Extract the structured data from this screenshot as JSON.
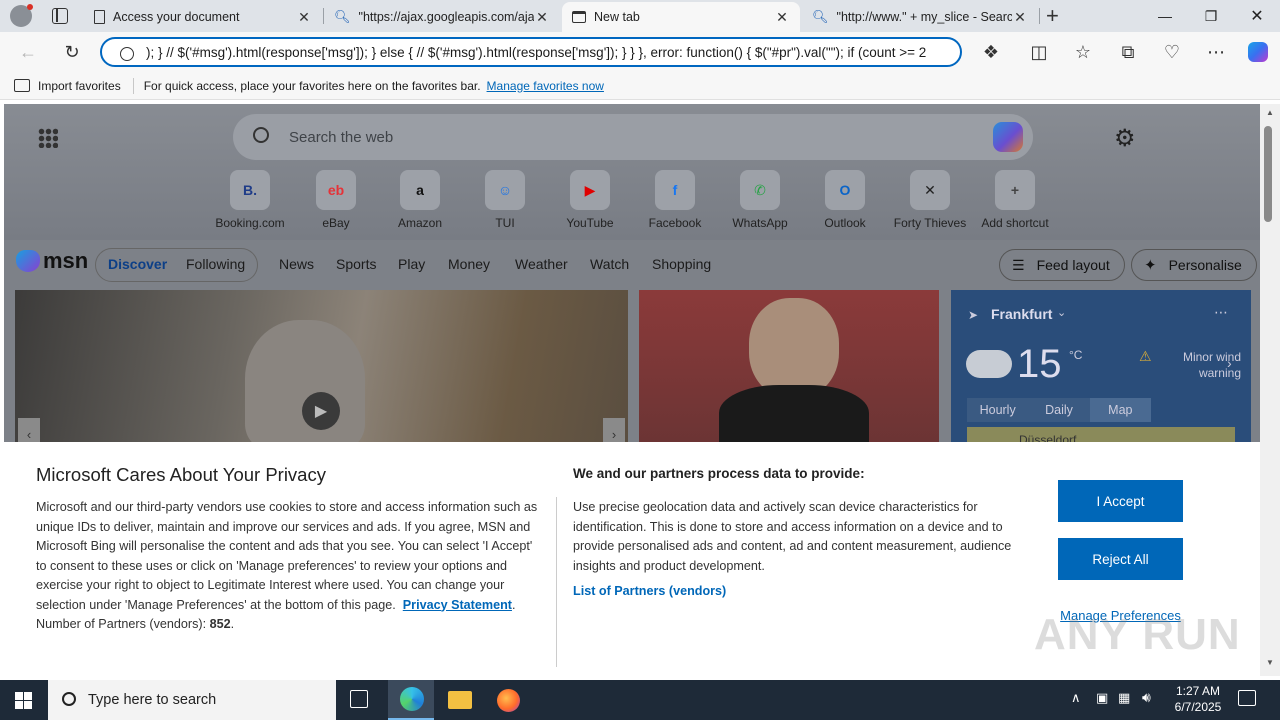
{
  "tabs": [
    {
      "title": "Access your document",
      "icon": "document-icon",
      "active": false
    },
    {
      "title": "\"https://ajax.googleapis.com/aja",
      "icon": "search-icon",
      "active": false
    },
    {
      "title": "New tab",
      "icon": "newtab-icon",
      "active": true
    },
    {
      "title": "\"http://www.\" + my_slice - Searc",
      "icon": "search-icon",
      "active": false
    }
  ],
  "address_bar": {
    "value": "); } // $('#msg').html(response['msg']); } else { // $('#msg').html(response['msg']); } } }, error: function() { $(\"#pr\").val(\"\"); if (count >= 2"
  },
  "favorites_bar": {
    "import_label": "Import favorites",
    "hint": "For quick access, place your favorites here on the favorites bar.",
    "manage_link": "Manage favorites now"
  },
  "newtab": {
    "search_placeholder": "Search the web",
    "shortcuts": [
      {
        "label": "Booking.com",
        "glyph": "B.",
        "color": "#1f3c88"
      },
      {
        "label": "eBay",
        "glyph": "eb",
        "color": "#e53238"
      },
      {
        "label": "Amazon",
        "glyph": "a",
        "color": "#111111"
      },
      {
        "label": "TUI",
        "glyph": "☺",
        "color": "#1a73e8"
      },
      {
        "label": "YouTube",
        "glyph": "▶",
        "color": "#e00000"
      },
      {
        "label": "Facebook",
        "glyph": "f",
        "color": "#1877f2"
      },
      {
        "label": "WhatsApp",
        "glyph": "✆",
        "color": "#25a244"
      },
      {
        "label": "Outlook",
        "glyph": "O",
        "color": "#0a64c8"
      },
      {
        "label": "Forty Thieves",
        "glyph": "✕",
        "color": "#222222"
      },
      {
        "label": "Add shortcut",
        "glyph": "+",
        "color": "#444444"
      }
    ]
  },
  "msn": {
    "logo": "msn",
    "toggle": [
      "Discover",
      "Following"
    ],
    "nav": [
      "News",
      "Sports",
      "Play",
      "Money",
      "Weather",
      "Watch",
      "Shopping"
    ],
    "feed_layout": "Feed layout",
    "personalise": "Personalise"
  },
  "weather": {
    "city": "Frankfurt",
    "temp": "15",
    "unit": "°C",
    "warning": "Minor wind warning",
    "tabs": [
      "Hourly",
      "Daily",
      "Map"
    ],
    "map_label": "Düsseldorf"
  },
  "privacy": {
    "title": "Microsoft Cares About Your Privacy",
    "body": "Microsoft and our third-party vendors use cookies to store and access information such as unique IDs to deliver, maintain and improve our services and ads. If you agree, MSN and Microsoft Bing will personalise the content and ads that you see. You can select 'I Accept' to consent to these uses or click on 'Manage preferences' to review your options and exercise your right to object to Legitimate Interest where used.  You can change your selection under 'Manage Preferences' at the bottom of this page.",
    "privacy_link": "Privacy Statement",
    "partners_label": "Number of Partners (vendors):",
    "partners_count": "852",
    "right_title": "We and our partners process data to provide:",
    "right_body": "Use precise geolocation data and actively scan device characteristics for identification. This is done to store and access information on a device and to provide personalised ads and content, ad and content measurement, audience insights and product development.",
    "partners_link": "List of Partners (vendors)",
    "accept": "I Accept",
    "reject": "Reject All",
    "manage": "Manage Preferences"
  },
  "watermark": "ANY RUN",
  "taskbar": {
    "search_placeholder": "Type here to search",
    "time": "1:27 AM",
    "date": "6/7/2025"
  }
}
